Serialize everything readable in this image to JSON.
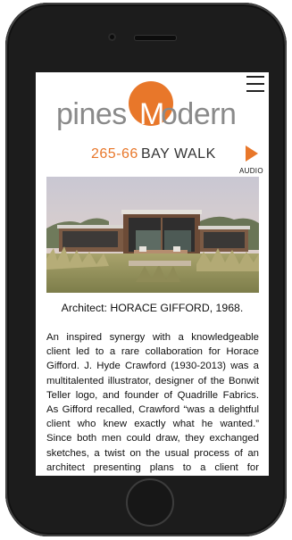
{
  "header": {
    "logo_left": "pines",
    "logo_mark": "M",
    "logo_right": "odern",
    "menu_icon": "hamburger-menu-icon",
    "brand_color": "#e8772a"
  },
  "stop": {
    "number": "265-66",
    "name": "BAY WALK",
    "audio_label": "AUDIO",
    "play_icon": "play-icon"
  },
  "photo": {
    "subject": "house-photo"
  },
  "caption": "Architect: HORACE GIFFORD, 1968.",
  "body": "An inspired synergy with a knowledgeable client led to a rare collaboration for Horace Gifford. J. Hyde Crawford (1930-2013) was a multitalented illustrator, designer of the Bonwit Teller logo, and founder of Quadrille Fabrics. As Gifford recalled, Crawford “was a delightful client who knew exactly what he wanted.” Since both men could draw, they exchanged sketches, a twist on the usual process of an architect presenting plans to a client for approval. Three separate high-"
}
